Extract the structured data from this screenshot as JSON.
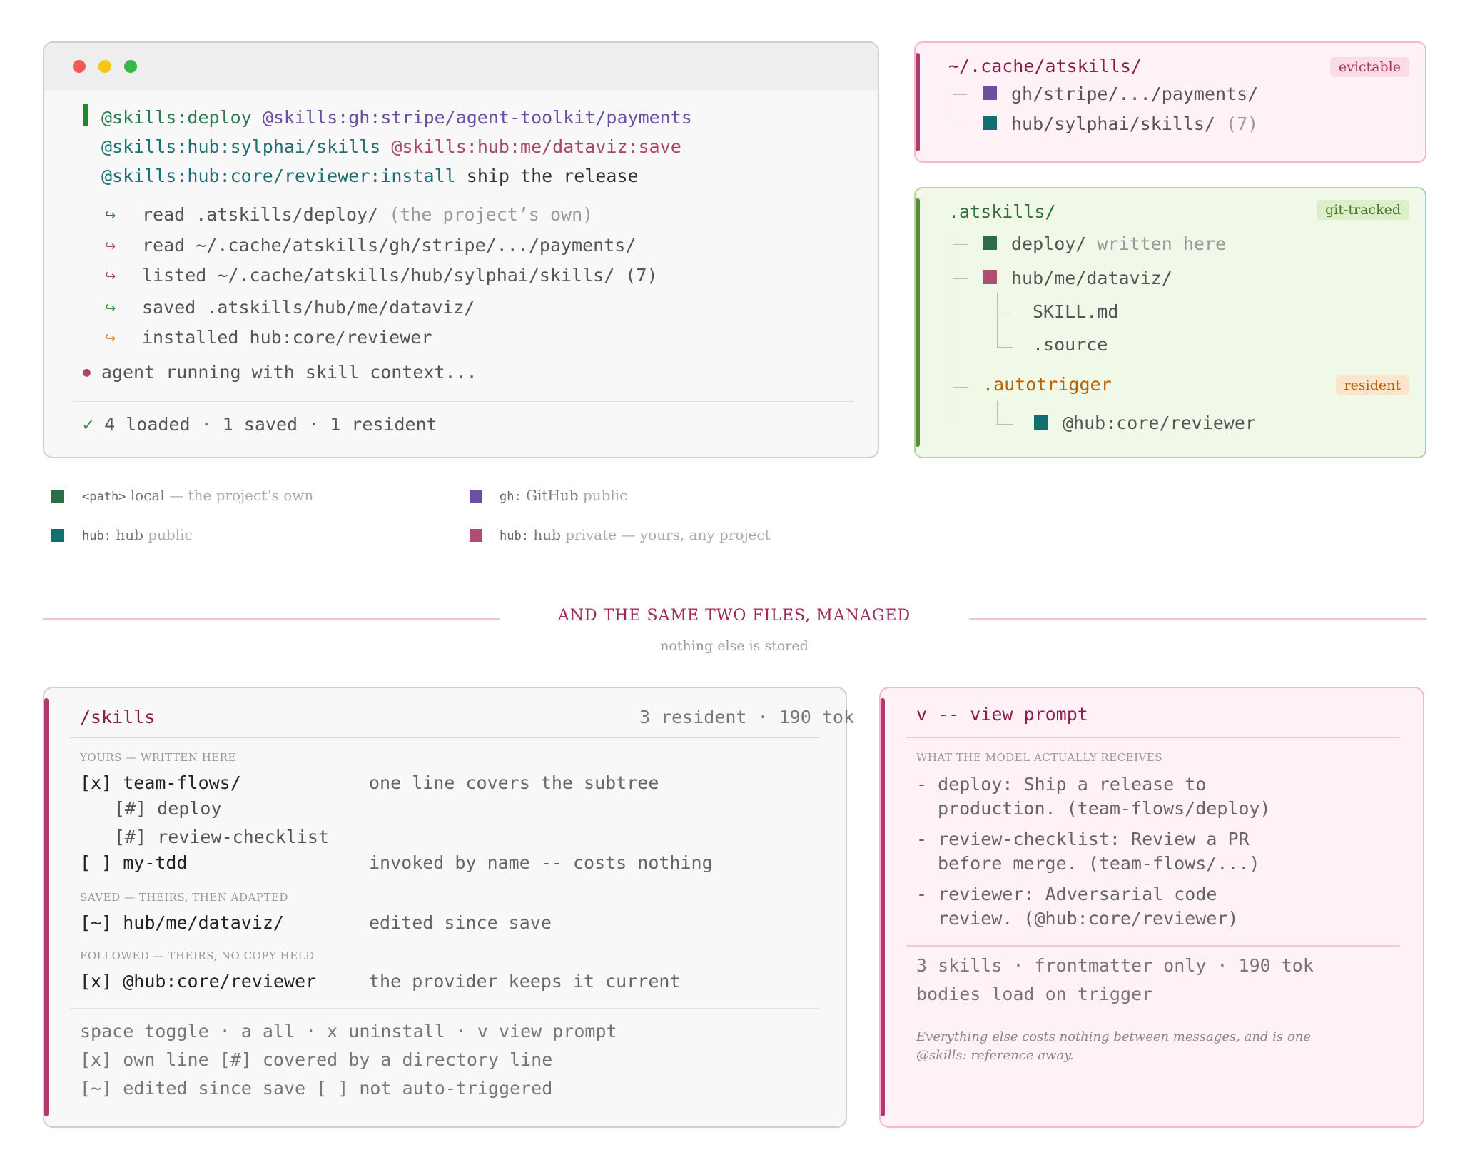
{
  "terminal": {
    "prompt": {
      "line1_a": "@skills:deploy",
      "line1_b": "@skills:gh:stripe/agent-toolkit/payments",
      "line2_a": "@skills:hub:sylphai/skills",
      "line2_b": "@skills:hub:me/dataviz:save",
      "line3_a": "@skills:hub:core/reviewer:install",
      "line3_b": "ship the release"
    },
    "arrow_glyph": "↪",
    "steps": [
      {
        "text": "read .atskills/deploy/",
        "note": "(the project’s own)",
        "color": "#2d7a52"
      },
      {
        "text": "read ~/.cache/atskills/gh/stripe/.../payments/",
        "note": "",
        "color": "#a8466d"
      },
      {
        "text": "listed ~/.cache/atskills/hub/sylphai/skills/ (7)",
        "note": "",
        "color": "#a8466d"
      },
      {
        "text": "saved .atskills/hub/me/dataviz/",
        "note": "",
        "color": "#2e9a3e"
      },
      {
        "text": "installed hub:core/reviewer",
        "note": "",
        "color": "#e08a2c"
      }
    ],
    "running": "agent running with skill context...",
    "bullet": "●",
    "check": "✓",
    "summary": "4 loaded · 1 saved · 1 resident"
  },
  "legend": [
    {
      "code": "<path>",
      "label": "local",
      "note": "— the project’s own",
      "color": "#2d6e47"
    },
    {
      "code": "gh:",
      "label": "GitHub",
      "note": "public",
      "color": "#6b4fa3"
    },
    {
      "code": "hub:",
      "label": "hub",
      "note": "public",
      "color": "#11706f"
    },
    {
      "code": "hub:",
      "label": "hub",
      "note": "private — yours, any project",
      "color": "#b04d72"
    }
  ],
  "cache_panel": {
    "title": "~/.cache/atskills/",
    "tag": "evictable",
    "items": [
      "gh/stripe/.../payments/",
      "hub/sylphai/skills/"
    ],
    "count": "(7)"
  },
  "local_panel": {
    "title": ".atskills/",
    "tag": "git-tracked",
    "deploy": "deploy/",
    "deploy_note": "written here",
    "dataviz": "hub/me/dataviz/",
    "files": [
      "SKILL.md",
      ".source"
    ],
    "autotrigger": ".autotrigger",
    "resident_tag": "resident",
    "reviewer": "@hub:core/reviewer"
  },
  "section": {
    "heading": "AND THE SAME TWO FILES, MANAGED",
    "subheading": "nothing else is stored"
  },
  "skills_panel": {
    "title": "/skills",
    "status": "3 resident · 190 tok",
    "yours_heading": "YOURS — WRITTEN HERE",
    "rows_yours": [
      {
        "mark": "[x]",
        "name": "team-flows/",
        "desc": "one line covers the subtree"
      },
      {
        "mark": "[#]",
        "name": "deploy",
        "desc": ""
      },
      {
        "mark": "[#]",
        "name": "review-checklist",
        "desc": ""
      },
      {
        "mark": "[ ]",
        "name": "my-tdd",
        "desc": "invoked by name -- costs nothing"
      }
    ],
    "saved_heading": "SAVED — THEIRS, THEN ADAPTED",
    "row_saved": {
      "mark": "[~]",
      "name": "hub/me/dataviz/",
      "desc": "edited since save"
    },
    "followed_heading": "FOLLOWED — THEIRS, NO COPY HELD",
    "row_followed": {
      "mark": "[x]",
      "name": "@hub:core/reviewer",
      "desc": "the provider keeps it current"
    },
    "help": [
      "space toggle · a all · x uninstall · v view prompt",
      "[x] own line   [#] covered by a directory line",
      "[~] edited since save   [ ] not auto-triggered"
    ]
  },
  "view_panel": {
    "title": "v -- view prompt",
    "heading": "WHAT THE MODEL ACTUALLY RECEIVES",
    "entries": [
      {
        "l1": "- deploy:  Ship a release to",
        "l2": "production.  (team-flows/deploy)"
      },
      {
        "l1": "- review-checklist:  Review a PR",
        "l2": "before merge.  (team-flows/...)"
      },
      {
        "l1": "- reviewer:  Adversarial code",
        "l2": "review.  (@hub:core/reviewer)"
      }
    ],
    "summary1": "3 skills · frontmatter only · 190 tok",
    "summary2": "bodies load on trigger",
    "footnote1": "Everything else costs nothing between messages, and is one",
    "footnote2": "@skills: reference away."
  },
  "colors": {
    "green": "#2d7a52",
    "purple": "#6b4fa3",
    "magenta": "#a8466d",
    "teal": "#1f6f73",
    "accent_bar": "#b03a6e",
    "olive": "#5a8a34"
  }
}
